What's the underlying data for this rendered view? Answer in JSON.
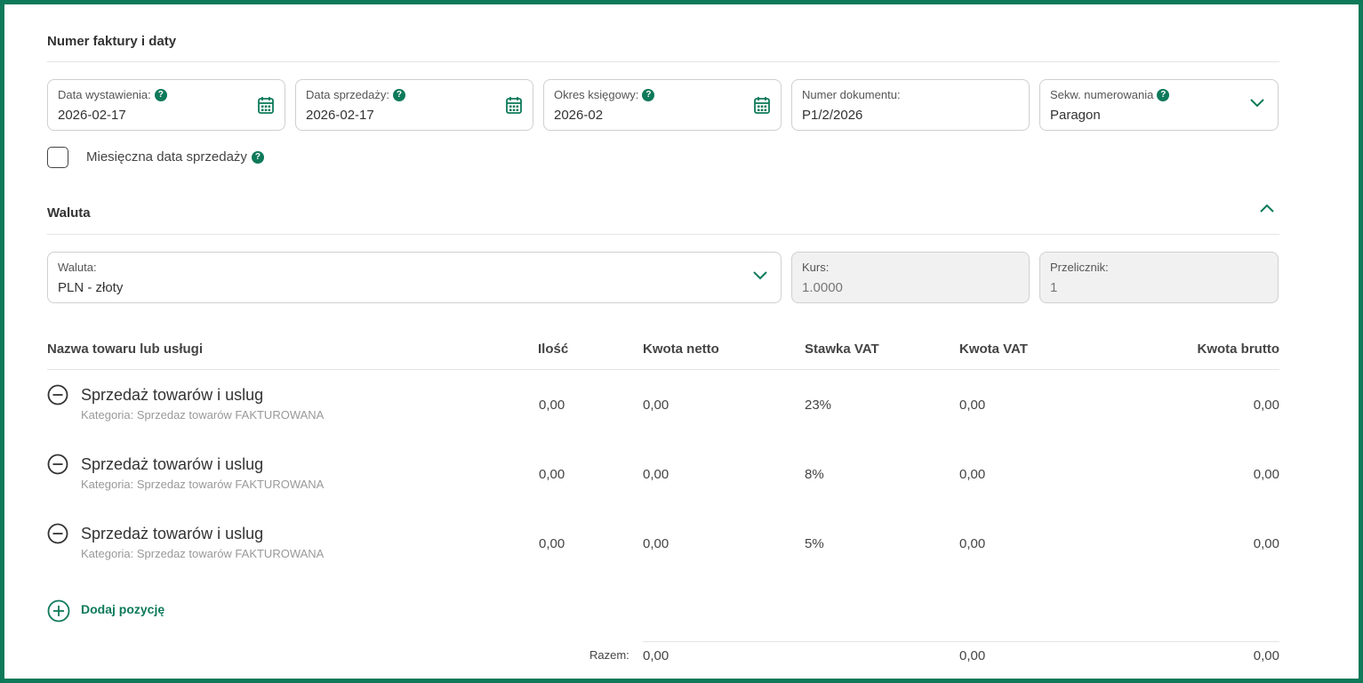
{
  "sections": {
    "invoice": "Numer faktury i daty",
    "currency": "Waluta"
  },
  "fields": {
    "issue_date": {
      "label": "Data wystawienia:",
      "value": "2026-02-17"
    },
    "sale_date": {
      "label": "Data sprzedaży:",
      "value": "2026-02-17"
    },
    "accounting_period": {
      "label": "Okres księgowy:",
      "value": "2026-02"
    },
    "document_number": {
      "label": "Numer dokumentu:",
      "value": "P1/2/2026"
    },
    "numbering_sequence": {
      "label": "Sekw. numerowania",
      "value": "Paragon"
    },
    "currency": {
      "label": "Waluta:",
      "value": "PLN - złoty"
    },
    "rate": {
      "label": "Kurs:",
      "value": "1.0000"
    },
    "converter": {
      "label": "Przelicznik:",
      "value": "1"
    }
  },
  "help_glyph": "?",
  "monthly_sale_date": {
    "label": "Miesięczna data sprzedaży",
    "checked": false
  },
  "table": {
    "headers": {
      "name": "Nazwa towaru lub usługi",
      "qty": "Ilość",
      "net": "Kwota netto",
      "vat_rate": "Stawka VAT",
      "vat": "Kwota VAT",
      "gross": "Kwota brutto"
    },
    "rows": [
      {
        "name": "Sprzedaż towarów i uslug",
        "category": "Kategoria: Sprzedaz towarów FAKTUROWANA",
        "qty": "0,00",
        "net": "0,00",
        "vat_rate": "23%",
        "vat": "0,00",
        "gross": "0,00"
      },
      {
        "name": "Sprzedaż towarów i uslug",
        "category": "Kategoria: Sprzedaz towarów FAKTUROWANA",
        "qty": "0,00",
        "net": "0,00",
        "vat_rate": "8%",
        "vat": "0,00",
        "gross": "0,00"
      },
      {
        "name": "Sprzedaż towarów i uslug",
        "category": "Kategoria: Sprzedaz towarów FAKTUROWANA",
        "qty": "0,00",
        "net": "0,00",
        "vat_rate": "5%",
        "vat": "0,00",
        "gross": "0,00"
      }
    ],
    "add_label": "Dodaj pozycję",
    "totals": {
      "label": "Razem:",
      "net": "0,00",
      "vat": "0,00",
      "gross": "0,00"
    }
  },
  "colors": {
    "accent": "#0e7a5a",
    "border": "#cfcfcf",
    "disabled_bg": "#f1f1f1"
  }
}
